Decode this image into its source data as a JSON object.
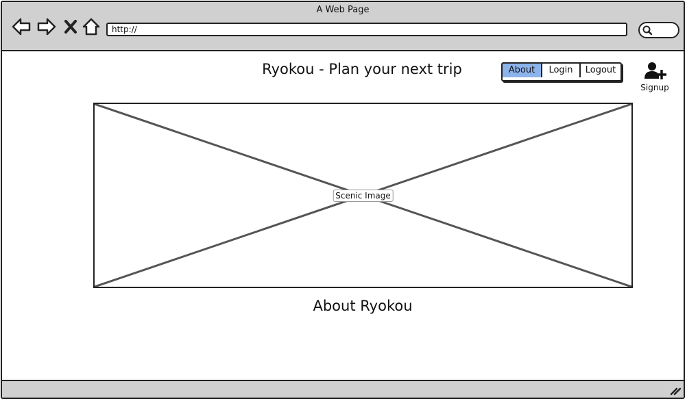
{
  "window": {
    "title": "A Web Page",
    "url": "http://"
  },
  "header": {
    "title": "Ryokou - Plan your next trip",
    "nav": [
      {
        "label": "About",
        "selected": true
      },
      {
        "label": "Login",
        "selected": false
      },
      {
        "label": "Logout",
        "selected": false
      }
    ],
    "signup_label": "Signup"
  },
  "hero": {
    "placeholder_label": "Scenic Image"
  },
  "main": {
    "heading": "About Ryokou"
  },
  "icons": {
    "back": "arrow-left-icon",
    "forward": "arrow-right-icon",
    "stop": "close-icon",
    "home": "home-icon",
    "search": "search-icon",
    "signup": "add-user-icon",
    "resize": "resize-grip-icon"
  },
  "colors": {
    "selected_tab": "#8db3ec",
    "chrome": "#d0d0d0",
    "outline": "#222222"
  }
}
